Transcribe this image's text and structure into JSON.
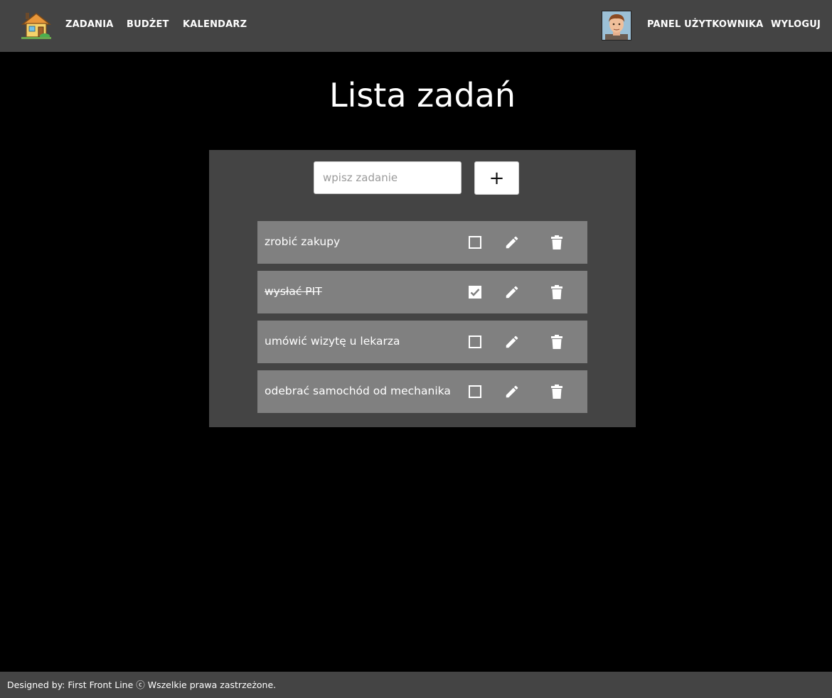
{
  "nav": {
    "logo_icon": "house-icon",
    "links": {
      "tasks": "ZADANIA",
      "budget": "BUDŻET",
      "calendar": "KALENDARZ",
      "user_panel": "PANEL UŻYTKOWNIKA",
      "logout": "WYLOGUJ"
    },
    "avatar_icon": "user-avatar"
  },
  "main": {
    "title": "Lista zadań",
    "new_task": {
      "placeholder": "wpisz zadanie",
      "value": "",
      "add_label": "+"
    },
    "tasks": [
      {
        "text": "zrobić zakupy",
        "done": false
      },
      {
        "text": "wysłać PIT",
        "done": true
      },
      {
        "text": "umówić wizytę u lekarza",
        "done": false
      },
      {
        "text": "odebrać samochód od mechanika",
        "done": false
      }
    ],
    "icons": {
      "checkbox": "checkbox-icon",
      "edit": "pencil-icon",
      "delete": "trash-icon"
    }
  },
  "footer": {
    "text": "Designed by: First Front Line ⓒ Wszelkie prawa zastrzeżone."
  },
  "colors": {
    "navbar_bg": "#444444",
    "page_bg": "#000000",
    "panel_bg": "#444444",
    "task_row_bg": "#808080",
    "text": "#ffffff"
  }
}
